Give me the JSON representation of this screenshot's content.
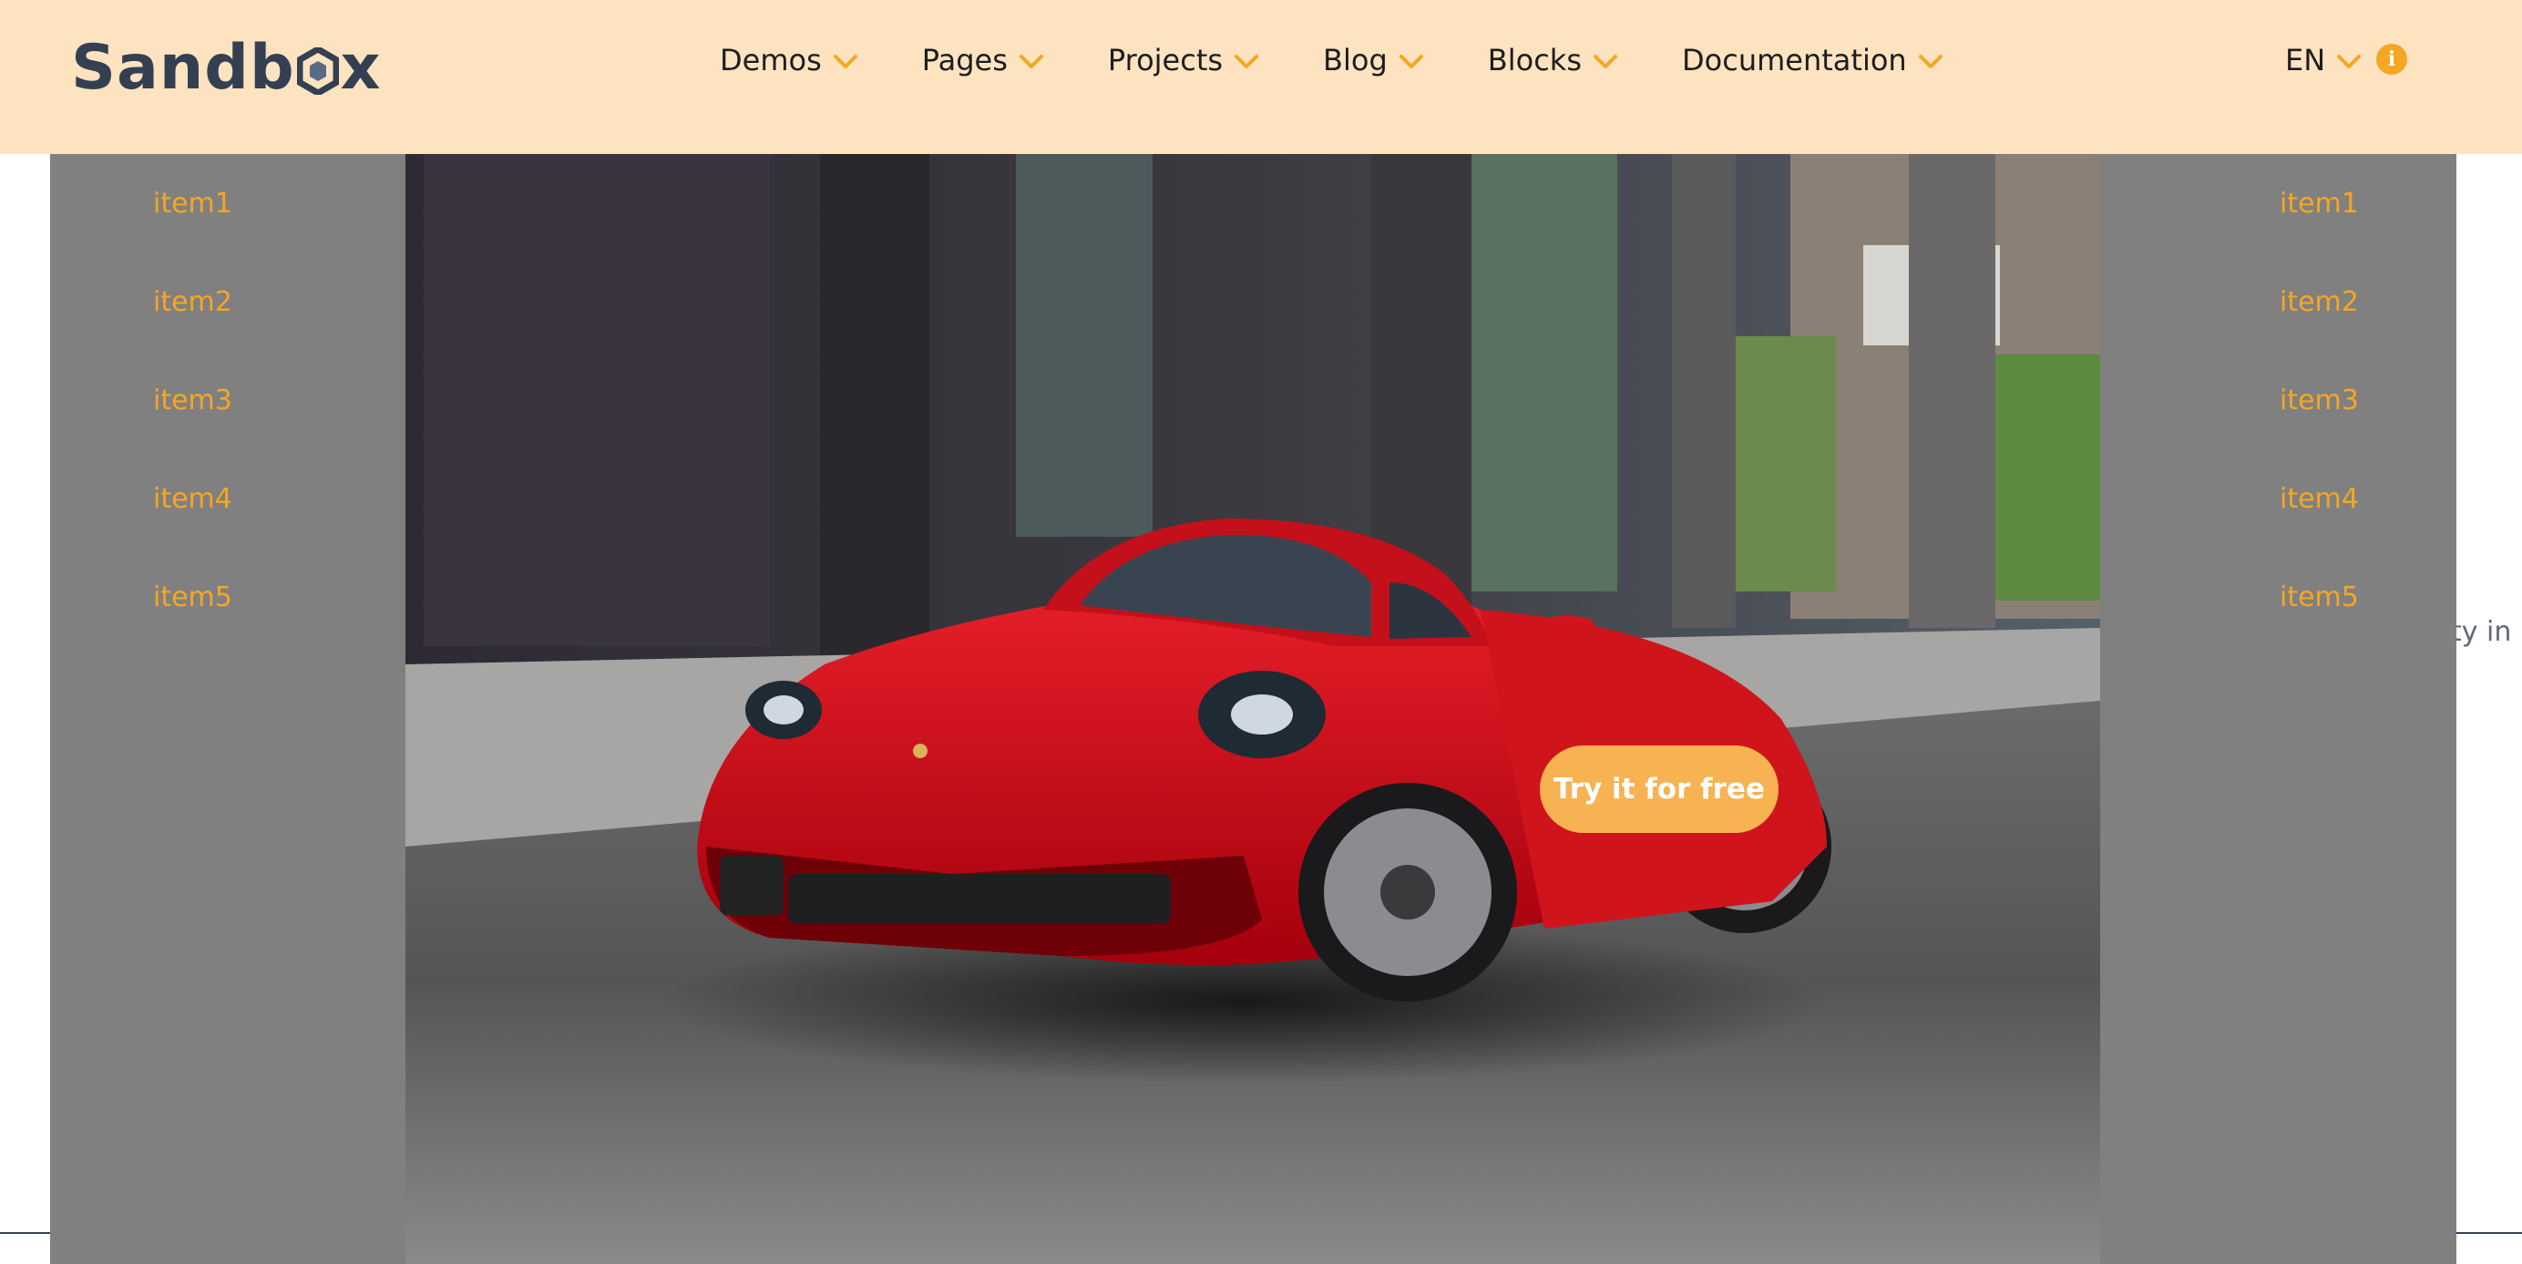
{
  "brand": {
    "name_prefix": "Sandb",
    "name_suffix": "x",
    "text_color": "#343f52"
  },
  "nav": {
    "items": [
      {
        "label": "Demos"
      },
      {
        "label": "Pages"
      },
      {
        "label": "Projects"
      },
      {
        "label": "Blog"
      },
      {
        "label": "Blocks"
      },
      {
        "label": "Documentation"
      }
    ],
    "chevron_icon": "chevron-down-icon",
    "accent": "#f5a623"
  },
  "language": {
    "selected": "EN"
  },
  "info_icon": {
    "glyph": "i",
    "color": "#f5a623"
  },
  "left_menu": {
    "items": [
      "item1",
      "item2",
      "item3",
      "item4",
      "item5"
    ]
  },
  "right_menu": {
    "items": [
      "item1",
      "item2",
      "item3",
      "item4",
      "item5"
    ]
  },
  "hero": {
    "cta_label": "Try it for free",
    "cta_color": "#f7b252"
  },
  "background_fragment": "ty in",
  "colors": {
    "header_bg": "#fde3c0",
    "side_bg": "#808080",
    "item_color": "#f5a623"
  }
}
